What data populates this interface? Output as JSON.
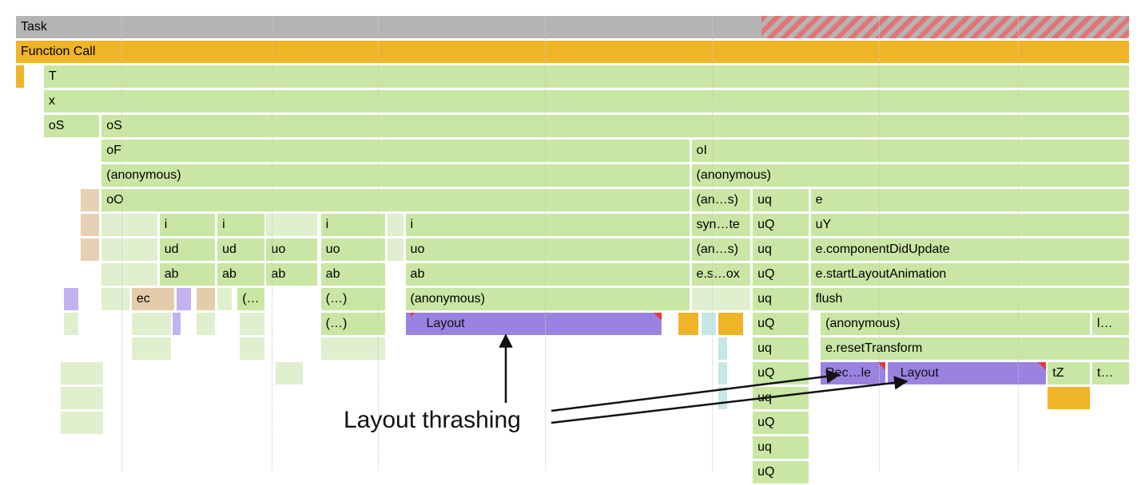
{
  "task_row": {
    "label": "Task"
  },
  "fcall_row": {
    "label": "Function Call"
  },
  "r3": [
    {
      "l": "T"
    }
  ],
  "r4": [
    {
      "l": "x"
    }
  ],
  "r5": [
    {
      "l": "oS"
    },
    {
      "l": "oS"
    }
  ],
  "r6": [
    {
      "l": "oF"
    },
    {
      "l": "oI"
    }
  ],
  "r7": [
    {
      "l": "(anonymous)"
    },
    {
      "l": "(anonymous)"
    }
  ],
  "r8": [
    {
      "l": "oO"
    },
    {
      "l": "(an…s)"
    },
    {
      "l": "uq"
    },
    {
      "l": "e"
    }
  ],
  "r9": [
    {
      "l": "i"
    },
    {
      "l": "i"
    },
    {
      "l": "i"
    },
    {
      "l": "i"
    },
    {
      "l": "syn…te"
    },
    {
      "l": "uQ"
    },
    {
      "l": "uY"
    }
  ],
  "r10": [
    {
      "l": "ud"
    },
    {
      "l": "ud"
    },
    {
      "l": "uo"
    },
    {
      "l": "uo"
    },
    {
      "l": "uo"
    },
    {
      "l": "(an…s)"
    },
    {
      "l": "uq"
    },
    {
      "l": "e.componentDidUpdate"
    }
  ],
  "r11": [
    {
      "l": "ab"
    },
    {
      "l": "ab"
    },
    {
      "l": "ab"
    },
    {
      "l": "ab"
    },
    {
      "l": "ab"
    },
    {
      "l": "e.s…ox"
    },
    {
      "l": "uQ"
    },
    {
      "l": "e.startLayoutAnimation"
    }
  ],
  "r12": [
    {
      "l": "ec"
    },
    {
      "l": "(…"
    },
    {
      "l": "(…)"
    },
    {
      "l": "(anonymous)"
    },
    {
      "l": "uq"
    },
    {
      "l": "flush"
    }
  ],
  "r13": [
    {
      "l": "(…)"
    },
    {
      "l": "Layout"
    },
    {
      "l": "uQ"
    },
    {
      "l": "(anonymous)"
    },
    {
      "l": "l…"
    }
  ],
  "r14": [
    {
      "l": "uq"
    },
    {
      "l": "e.resetTransform"
    }
  ],
  "r15": [
    {
      "l": "uQ"
    },
    {
      "l": "Rec…le"
    },
    {
      "l": "Layout"
    },
    {
      "l": "tZ"
    },
    {
      "l": "t…"
    }
  ],
  "r16": [
    {
      "l": "uq"
    }
  ],
  "r17": [
    {
      "l": "uQ"
    }
  ],
  "r18": [
    {
      "l": "uq"
    }
  ],
  "r19": [
    {
      "l": "uQ"
    }
  ],
  "annotation": {
    "label": "Layout thrashing"
  },
  "gridlines_pct": [
    9.5,
    23,
    32.5,
    47.5,
    62.5,
    77.5,
    90
  ]
}
